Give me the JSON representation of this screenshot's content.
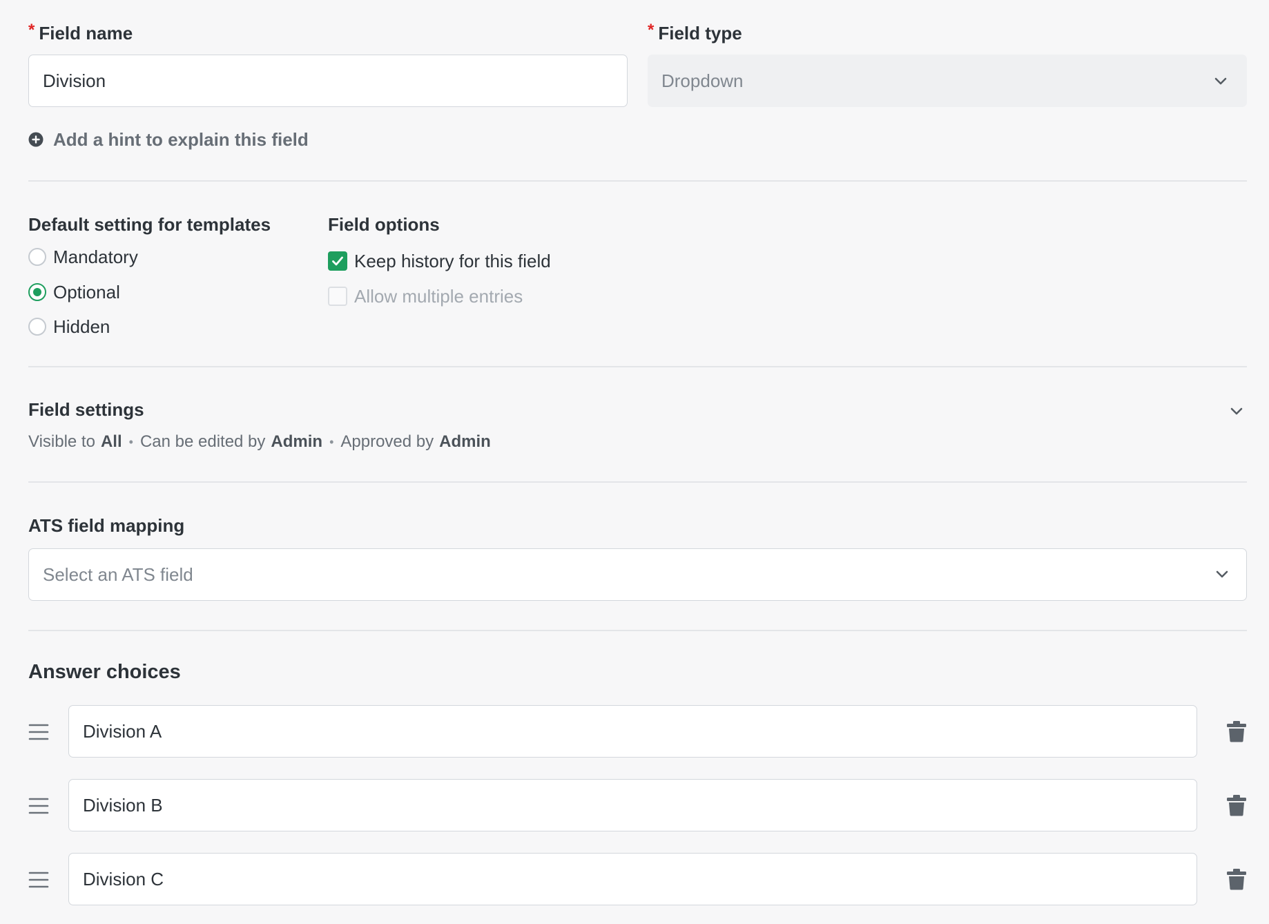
{
  "field_name": {
    "label": "Field name",
    "required_mark": "*",
    "value": "Division"
  },
  "field_type": {
    "label": "Field type",
    "required_mark": "*",
    "value": "Dropdown",
    "disabled": true
  },
  "hint_link": {
    "label": "Add a hint to explain this field",
    "icon": "plus-circle-icon"
  },
  "default_setting": {
    "heading": "Default setting for templates",
    "options": [
      {
        "label": "Mandatory",
        "selected": false
      },
      {
        "label": "Optional",
        "selected": true
      },
      {
        "label": "Hidden",
        "selected": false
      }
    ]
  },
  "field_options": {
    "heading": "Field options",
    "options": [
      {
        "label": "Keep history for this field",
        "checked": true,
        "disabled": false
      },
      {
        "label": "Allow multiple entries",
        "checked": false,
        "disabled": true
      }
    ]
  },
  "field_settings": {
    "heading": "Field settings",
    "visible_prefix": "Visible to",
    "visible_value": "All",
    "edited_prefix": "Can be edited by",
    "edited_value": "Admin",
    "approved_prefix": "Approved by",
    "approved_value": "Admin",
    "separator": "•"
  },
  "ats_mapping": {
    "heading": "ATS field mapping",
    "placeholder": "Select an ATS field"
  },
  "answer_choices": {
    "heading": "Answer choices",
    "items": [
      {
        "value": "Division A"
      },
      {
        "value": "Division B"
      },
      {
        "value": "Division C"
      }
    ]
  },
  "colors": {
    "accent": "#1e9e5e",
    "required": "#e02424",
    "background": "#f7f7f8"
  }
}
